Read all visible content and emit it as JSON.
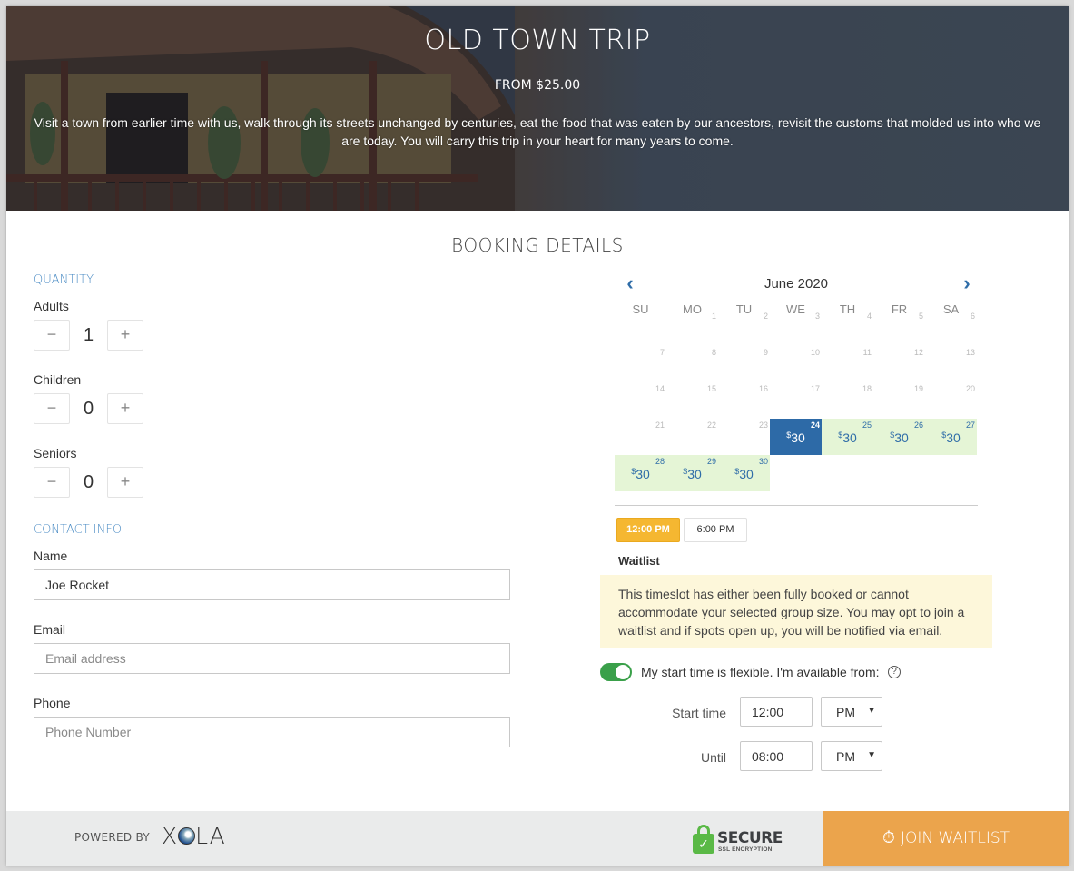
{
  "hero": {
    "title": "OLD TOWN TRIP",
    "price": "FROM $25.00",
    "description": "Visit a town from earlier time with us, walk through its streets unchanged by centuries, eat the food that was eaten by our ancestors, revisit the customs that molded us into who we are today. You will carry this trip in your heart for many years to come."
  },
  "section_title": "BOOKING DETAILS",
  "quantity": {
    "heading": "QUANTITY",
    "items": [
      {
        "label": "Adults",
        "value": "1"
      },
      {
        "label": "Children",
        "value": "0"
      },
      {
        "label": "Seniors",
        "value": "0"
      }
    ],
    "minus_symbol": "−",
    "plus_symbol": "+"
  },
  "contact": {
    "heading": "CONTACT INFO",
    "name_label": "Name",
    "name_value": "Joe Rocket",
    "email_label": "Email",
    "email_placeholder": "Email address",
    "phone_label": "Phone",
    "phone_placeholder": "Phone Number"
  },
  "calendar": {
    "month": "June 2020",
    "prev_icon": "‹",
    "next_icon": "›",
    "weekdays": [
      "SU",
      "MO",
      "TU",
      "WE",
      "TH",
      "FR",
      "SA"
    ],
    "first_weekday_index": 1,
    "days_in_month": 30,
    "available_days": [
      24,
      25,
      26,
      27,
      28,
      29,
      30
    ],
    "selected_day": 24,
    "currency_symbol": "$",
    "price": "30"
  },
  "times": [
    {
      "label": "12:00 PM",
      "active": true
    },
    {
      "label": "6:00 PM",
      "active": false
    }
  ],
  "waitlist": {
    "title": "Waitlist",
    "message": "This timeslot has either been fully booked or cannot accommodate your selected group size. You may opt to join a waitlist and if spots open up, you will be notified via email."
  },
  "flexible": {
    "enabled": true,
    "label": "My start time is flexible. I'm available from:",
    "help_icon": "?",
    "start_label": "Start time",
    "start_value": "12:00",
    "start_ampm": "PM",
    "until_label": "Until",
    "until_value": "08:00",
    "until_ampm": "PM",
    "chevron": "⌄"
  },
  "footer": {
    "powered_by": "POWERED BY",
    "logo_x": "X",
    "logo_la": "LA",
    "secure": "SECURE",
    "secure_sub": "SSL ENCRYPTION",
    "lock_check": "✓",
    "join_icon": "⏱",
    "join_label": "JOIN WAITLIST"
  },
  "colors": {
    "accent_blue": "#2d6aa7",
    "available_green": "#e5f5d6",
    "time_active": "#f5b731",
    "join_button": "#eba44c",
    "toggle_on": "#3aa04a",
    "waitlist_bg": "#fdf7da"
  }
}
